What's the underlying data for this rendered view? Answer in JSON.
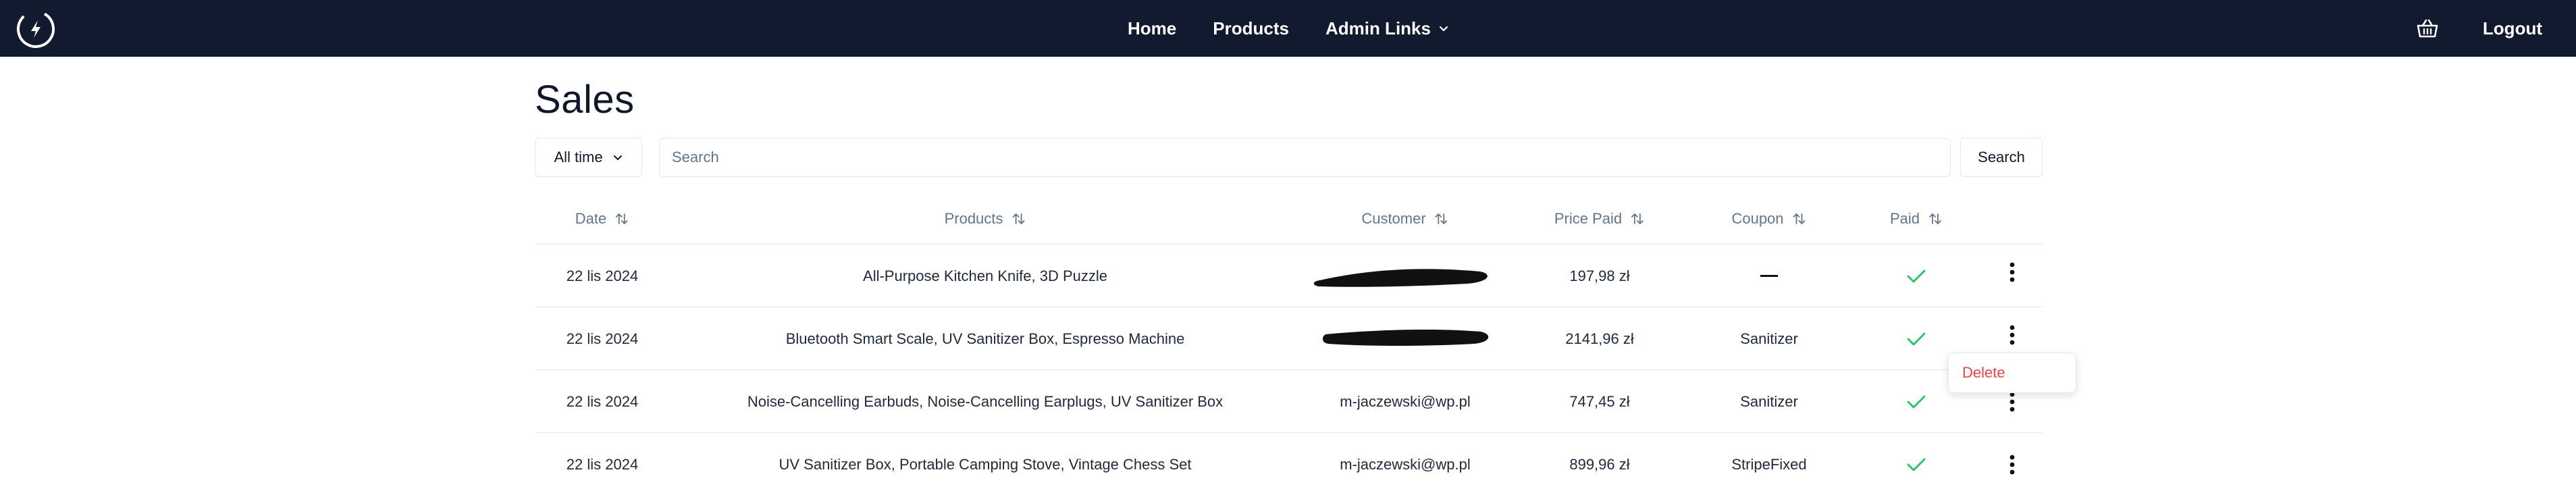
{
  "nav": {
    "links": [
      "Home",
      "Products",
      "Admin Links"
    ],
    "logout": "Logout",
    "icons": {
      "logo": "brand-logo",
      "cart": "basket-icon",
      "admin_dropdown": "chevron-down-icon"
    }
  },
  "page": {
    "title": "Sales"
  },
  "filters": {
    "time_range": "All time",
    "search_placeholder": "Search",
    "search_button": "Search"
  },
  "table": {
    "columns": [
      "Date",
      "Products",
      "Customer",
      "Price Paid",
      "Coupon",
      "Paid"
    ],
    "rows": [
      {
        "date": "22 lis 2024",
        "products": "All-Purpose Kitchen Knife, 3D Puzzle",
        "customer": "",
        "customer_redacted": true,
        "price": "197,98 zł",
        "coupon": "",
        "paid": true
      },
      {
        "date": "22 lis 2024",
        "products": "Bluetooth Smart Scale, UV Sanitizer Box, Espresso Machine",
        "customer": "",
        "customer_redacted": true,
        "price": "2141,96 zł",
        "coupon": "Sanitizer",
        "paid": true
      },
      {
        "date": "22 lis 2024",
        "products": "Noise-Cancelling Earbuds, Noise-Cancelling Earplugs, UV Sanitizer Box",
        "customer": "m-jaczewski@wp.pl",
        "customer_redacted": false,
        "price": "747,45 zł",
        "coupon": "Sanitizer",
        "paid": true
      },
      {
        "date": "22 lis 2024",
        "products": "UV Sanitizer Box, Portable Camping Stove, Vintage Chess Set",
        "customer": "m-jaczewski@wp.pl",
        "customer_redacted": false,
        "price": "899,96 zł",
        "coupon": "StripeFixed",
        "paid": true
      }
    ]
  },
  "row_menu": {
    "delete": "Delete"
  },
  "colors": {
    "navbar": "#111a2e",
    "check": "#22c55e",
    "danger": "#ef4444",
    "muted": "#64748b"
  }
}
